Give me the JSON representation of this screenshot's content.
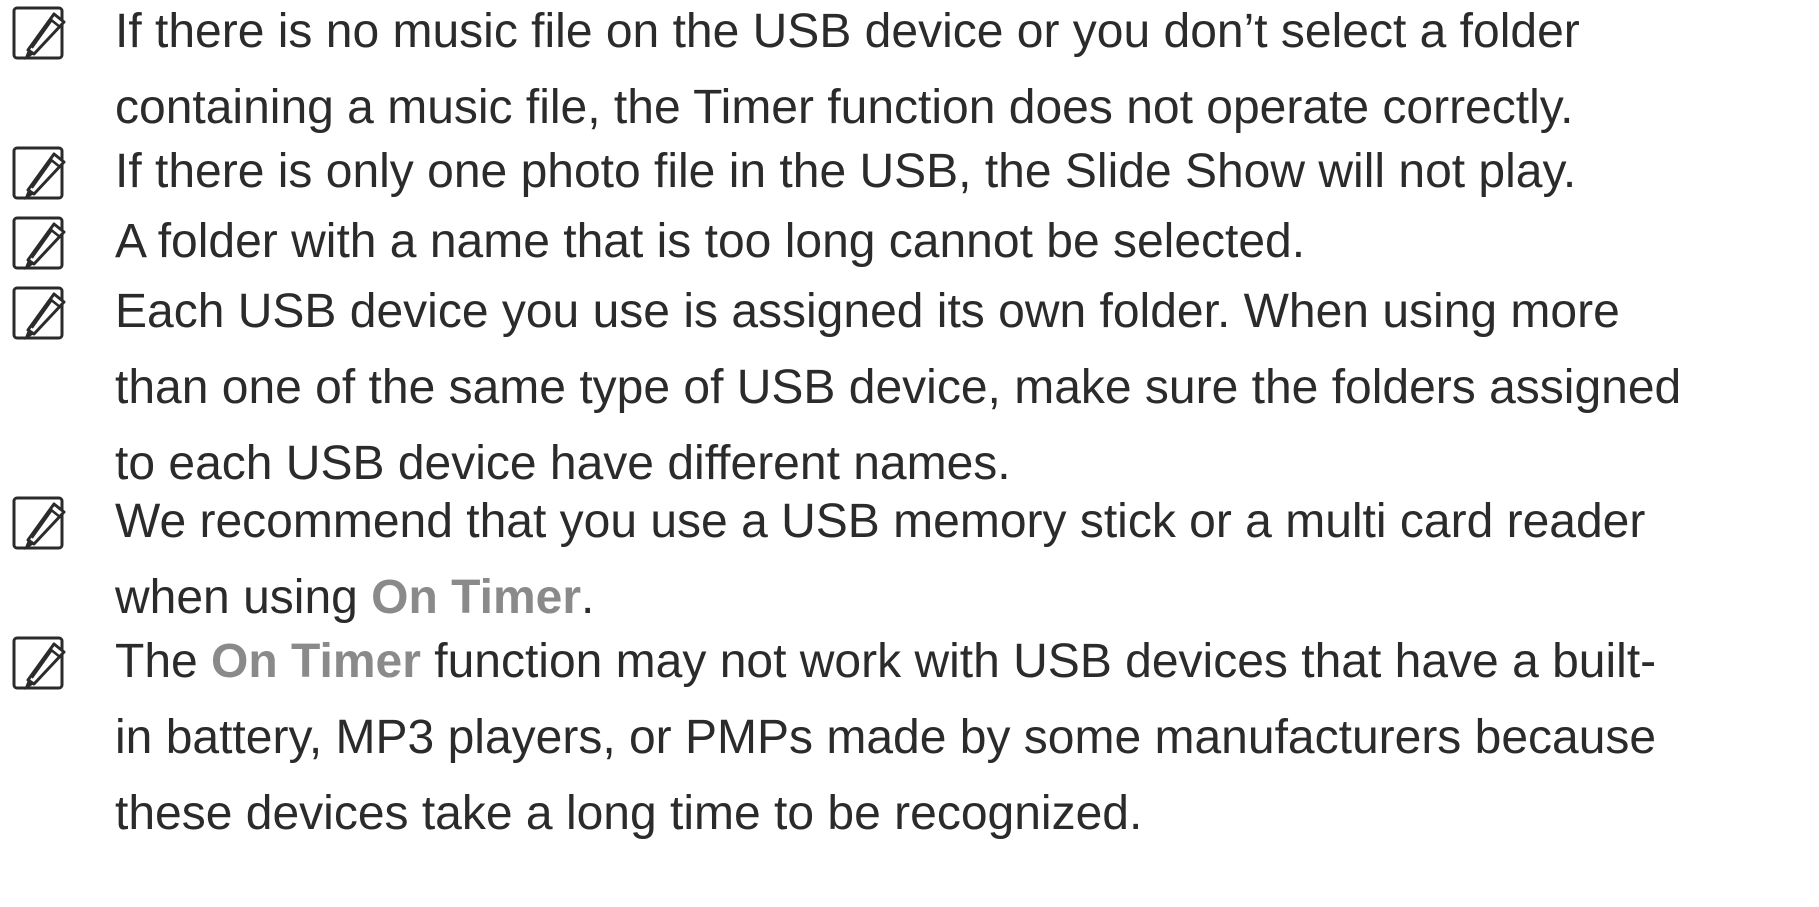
{
  "notes": [
    {
      "icon": "note-pencil-icon",
      "lines": [
        [
          {
            "t": "If there is no music file on the USB device or you don’t select a folder"
          }
        ],
        [
          {
            "t": "containing a music file, the Timer function does not operate correctly."
          }
        ]
      ]
    },
    {
      "icon": "note-pencil-icon",
      "lines": [
        [
          {
            "t": "If there is only one photo file in the USB, the Slide Show will not play."
          }
        ]
      ]
    },
    {
      "icon": "note-pencil-icon",
      "lines": [
        [
          {
            "t": "A folder with a name that is too long cannot be selected."
          }
        ]
      ]
    },
    {
      "icon": "note-pencil-icon",
      "lines": [
        [
          {
            "t": "Each USB device you use is assigned its own folder. When using more"
          }
        ],
        [
          {
            "t": "than one of the same type of USB device, make sure the folders assigned"
          }
        ],
        [
          {
            "t": "to each USB device have different names."
          }
        ]
      ]
    },
    {
      "icon": "note-pencil-icon",
      "lines": [
        [
          {
            "t": "We recommend that you use a USB memory stick or a multi card reader"
          }
        ],
        [
          {
            "t": "when using "
          },
          {
            "t": "On Timer",
            "hl": true
          },
          {
            "t": "."
          }
        ]
      ]
    },
    {
      "icon": "note-pencil-icon",
      "lines": [
        [
          {
            "t": "The "
          },
          {
            "t": "On Timer",
            "hl": true
          },
          {
            "t": " function may not work with USB devices that have a built-"
          }
        ],
        [
          {
            "t": "in battery, MP3 players, or PMPs made by some manufacturers because"
          }
        ],
        [
          {
            "t": "these devices take a long time to be recognized."
          }
        ]
      ]
    }
  ],
  "colors": {
    "text": "#2b2b2b",
    "highlight": "#8a8a8a",
    "icon": "#2b2b2b"
  }
}
